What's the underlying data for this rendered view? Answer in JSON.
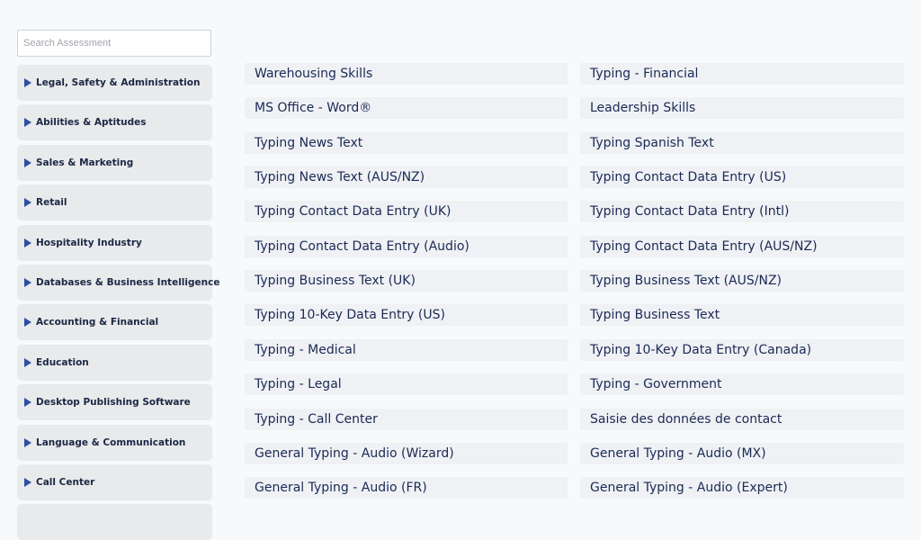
{
  "search": {
    "placeholder": "Search Assessment"
  },
  "categories": [
    "Legal, Safety & Administration",
    "Abilities & Aptitudes",
    "Sales & Marketing",
    "Retail",
    "Hospitality Industry",
    "Databases & Business Intelligence",
    "Accounting & Financial",
    "Education",
    "Desktop Publishing Software",
    "Language & Communication",
    "Call Center"
  ],
  "tests": [
    [
      "Warehousing Skills",
      "Typing - Financial"
    ],
    [
      "MS Office - Word®",
      "Leadership Skills"
    ],
    [
      "Typing News Text",
      "Typing Spanish Text"
    ],
    [
      "Typing News Text (AUS/NZ)",
      "Typing Contact Data Entry (US)"
    ],
    [
      "Typing Contact Data Entry (UK)",
      "Typing Contact Data Entry (Intl)"
    ],
    [
      "Typing Contact Data Entry (Audio)",
      "Typing Contact Data Entry (AUS/NZ)"
    ],
    [
      "Typing Business Text (UK)",
      "Typing Business Text (AUS/NZ)"
    ],
    [
      "Typing 10-Key Data Entry (US)",
      "Typing Business Text"
    ],
    [
      "Typing - Medical",
      "Typing 10-Key Data Entry (Canada)"
    ],
    [
      "Typing - Legal",
      "Typing - Government"
    ],
    [
      "Typing - Call Center",
      "Saisie des données de contact"
    ],
    [
      "General Typing - Audio (Wizard)",
      "General Typing - Audio (MX)"
    ],
    [
      "General Typing - Audio (FR)",
      "General Typing - Audio (Expert)"
    ]
  ]
}
